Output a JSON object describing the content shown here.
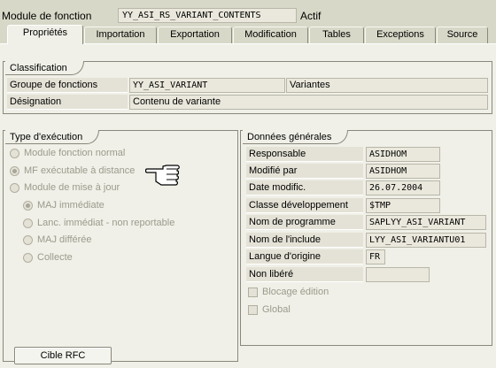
{
  "header": {
    "label": "Module de fonction",
    "value": "YY_ASI_RS_VARIANT_CONTENTS",
    "status": "Actif"
  },
  "tabs": [
    {
      "label": "Propriétés",
      "active": true
    },
    {
      "label": "Importation",
      "active": false
    },
    {
      "label": "Exportation",
      "active": false
    },
    {
      "label": "Modification",
      "active": false
    },
    {
      "label": "Tables",
      "active": false
    },
    {
      "label": "Exceptions",
      "active": false
    },
    {
      "label": "Source",
      "active": false
    }
  ],
  "classification": {
    "title": "Classification",
    "rows": [
      {
        "label": "Groupe de fonctions",
        "value": "YY_ASI_VARIANT",
        "description": "Variantes"
      },
      {
        "label": "Désignation",
        "value": "Contenu de variante"
      }
    ]
  },
  "execution": {
    "title": "Type d'exécution",
    "options": [
      {
        "label": "Module fonction normal",
        "checked": false
      },
      {
        "label": "MF exécutable à distance",
        "checked": true
      },
      {
        "label": "Module de mise à jour",
        "checked": false
      }
    ],
    "sub_options": [
      {
        "label": "MAJ immédiate",
        "checked": true
      },
      {
        "label": "Lanc. immédiat - non reportable",
        "checked": false
      },
      {
        "label": "MAJ différée",
        "checked": false
      },
      {
        "label": "Collecte",
        "checked": false
      }
    ],
    "rfc_button": "Cible RFC"
  },
  "general": {
    "title": "Données générales",
    "rows": [
      {
        "label": "Responsable",
        "value": "ASIDHOM"
      },
      {
        "label": "Modifié par",
        "value": "ASIDHOM"
      },
      {
        "label": "Date modific.",
        "value": "26.07.2004"
      },
      {
        "label": "Classe développement",
        "value": "$TMP"
      },
      {
        "label": "Nom de programme",
        "value": "SAPLYY_ASI_VARIANT"
      },
      {
        "label": "Nom de l'include",
        "value": "LYY_ASI_VARIANTU01"
      },
      {
        "label": "Langue d'origine",
        "value": "FR"
      },
      {
        "label": "Non libéré",
        "value": ""
      }
    ],
    "checkboxes": [
      {
        "label": "Blocage édition",
        "checked": false
      },
      {
        "label": "Global",
        "checked": false
      }
    ]
  },
  "colors": {
    "background": "#d8d8c8",
    "panel": "#f0f0e8",
    "border": "#8a887c",
    "disabled_text": "#9c9a8c"
  },
  "icons": {
    "cursor": "pointing-hand-icon"
  }
}
